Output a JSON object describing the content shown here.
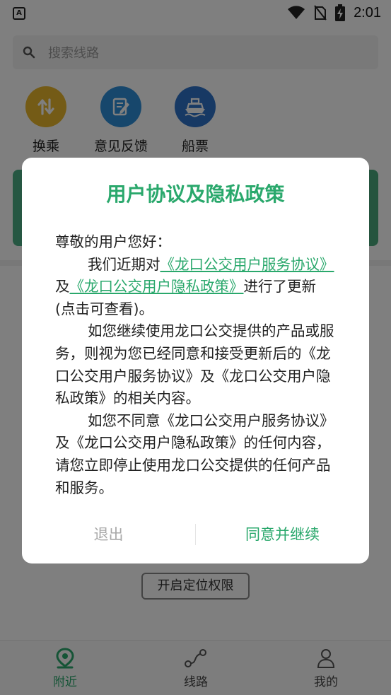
{
  "status_bar": {
    "time": "2:01",
    "notification_glyph": "A"
  },
  "search": {
    "placeholder": "搜索线路"
  },
  "quick_actions": [
    {
      "label": "换乘",
      "icon": "transfer-icon",
      "color": "#e8b62c"
    },
    {
      "label": "意见反馈",
      "icon": "feedback-icon",
      "color": "#2f8fd8"
    },
    {
      "label": "船票",
      "icon": "ship-icon",
      "color": "#2f72c8"
    }
  ],
  "location_button": "开启定位权限",
  "tabs": [
    {
      "label": "附近",
      "icon": "location-pin-icon",
      "active": true
    },
    {
      "label": "线路",
      "icon": "route-icon",
      "active": false
    },
    {
      "label": "我的",
      "icon": "user-icon",
      "active": false
    }
  ],
  "dialog": {
    "title": "用户协议及隐私政策",
    "greeting": "尊敬的用户您好：",
    "p1_prefix": "我们近期对",
    "p1_link1": "《龙口公交用户服务协议》",
    "p1_mid": "及",
    "p1_link2": "《龙口公交用户隐私政策》",
    "p1_suffix": "进行了更新(点击可查看)。",
    "p2": "如您继续使用龙口公交提供的产品或服务，则视为您已经同意和接受更新后的《龙口公交用户服务协议》及《龙口公交用户隐私政策》的相关内容。",
    "p3": "如您不同意《龙口公交用户服务协议》及《龙口公交用户隐私政策》的任何内容，请您立即停止使用龙口公交提供的任何产品和服务。",
    "exit_label": "退出",
    "agree_label": "同意并继续"
  },
  "colors": {
    "accent": "#2aa86c",
    "muted": "#a8a8a8"
  }
}
